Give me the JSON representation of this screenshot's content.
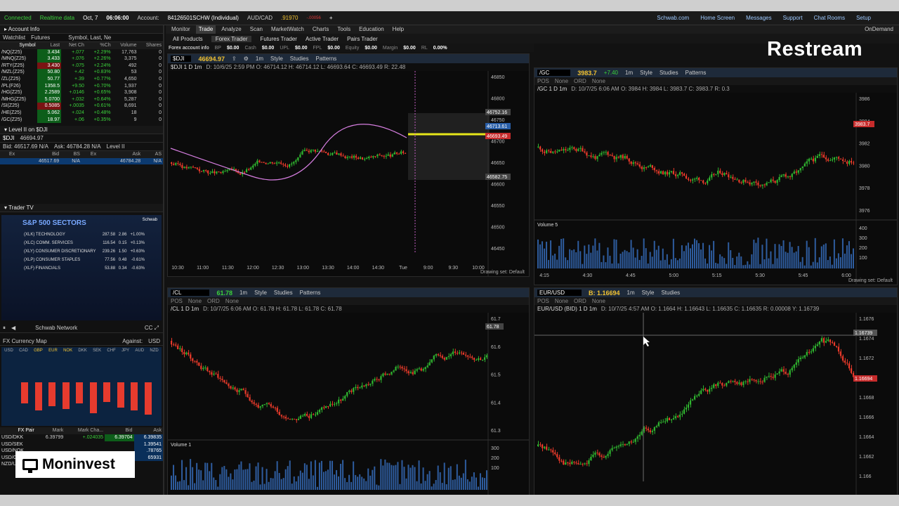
{
  "topbar": {
    "status": "Connected",
    "realtime": "Realtime data",
    "date": "Oct, 7",
    "time": "06:06:00",
    "account_label": "Account:",
    "account": "84126501SCHW (Individual)",
    "pair": "AUD/CAD",
    "pair_price": ".91970",
    "pair_chg": "-.00056",
    "links": [
      "Schwab.com",
      "Home Screen",
      "Messages",
      "Support",
      "Chat Rooms",
      "Setup"
    ]
  },
  "left": {
    "account_info": "Account Info",
    "watchlist": "Watchlist",
    "futures": "Futures",
    "symbol_lookup": "Symbol, Last, Ne",
    "headers": [
      "Symbol",
      "Last",
      "Net Ch",
      "%Ch",
      "Volume",
      "Shares"
    ],
    "rows": [
      [
        "/NQ(Z25)",
        "3.434",
        "+.077",
        "+2.29%",
        "17,763",
        "0"
      ],
      [
        "/MNQ(Z25)",
        "3.433",
        "+.076",
        "+2.26%",
        "3,375",
        "0"
      ],
      [
        "/RTY(Z25)",
        "3.430",
        "+.075",
        "+2.24%",
        "492",
        "0"
      ],
      [
        "/MZL(Z25)",
        "50.80",
        "+.42",
        "+0.83%",
        "53",
        "0"
      ],
      [
        "/ZL(Z25)",
        "50.77",
        "+.39",
        "+0.77%",
        "4,650",
        "0"
      ],
      [
        "/PL(F26)",
        "1358.5",
        "+9.50",
        "+0.70%",
        "1,937",
        "0"
      ],
      [
        "/HG(Z25)",
        "2.2589",
        "+.0146",
        "+0.65%",
        "3,908",
        "0"
      ],
      [
        "/MHG(Z25)",
        "5.0700",
        "+.032",
        "+0.64%",
        "5,287",
        "0"
      ],
      [
        "/SI(Z25)",
        "0.5085",
        "+.0035",
        "+0.61%",
        "8,691",
        "0"
      ],
      [
        "/HE(Z25)",
        "5.062",
        "+.024",
        "+0.48%",
        "18",
        "0"
      ],
      [
        "/GC(Z25)",
        "18.97",
        "+.06",
        "+0.35%",
        "9",
        "0"
      ]
    ],
    "level2_title": "Level II on $DJI",
    "level2_sym": "$DJI",
    "level2_price": "46694.97",
    "bid": "Bid: 46517.69 N/A",
    "ask": "Ask: 46784.28 N/A",
    "level_label": "Level II",
    "l2_headers": [
      "Ex",
      "Bid",
      "BS",
      "Ex",
      "Ask",
      "AS"
    ],
    "l2_row": [
      "",
      "46517.69",
      "N/A",
      "",
      "46784.28",
      "N/A"
    ],
    "trader_tv": "Trader TV",
    "tv_title": "S&P 500 SECTORS",
    "tv_brand": "Schwab",
    "sectors": [
      [
        "(XLK) TECHNOLOGY",
        "287.58",
        "2.86",
        "+1.00%"
      ],
      [
        "(XLC) COMM. SERVICES",
        "116.54",
        "0.15",
        "+0.13%"
      ],
      [
        "(XLY) CONSUMER DISCRETIONARY",
        "239.26",
        "1.50",
        "+0.63%"
      ],
      [
        "(XLP) CONSUMER STAPLES",
        "77.56",
        "0.48",
        "-0.61%"
      ],
      [
        "(XLF) FINANCIALS",
        "53.88",
        "0.34",
        "-0.63%"
      ]
    ],
    "schwab_network": "Schwab Network",
    "fx_title": "FX Currency Map",
    "against_label": "Against:",
    "against": "USD",
    "fx_currencies": [
      "USD",
      "CAD",
      "GBP",
      "EUR",
      "NOK",
      "DKK",
      "SEK",
      "CHF",
      "JPY",
      "AUD",
      "NZD"
    ],
    "fx_headers": [
      "FX Pair",
      "Mark",
      "Mark Cha...",
      "Bid",
      "Ask"
    ],
    "fx_rows": [
      [
        "USD/DKK",
        "6.39799",
        "+.024035",
        "6.39704",
        "6.39835"
      ],
      [
        "USD/SEK",
        "",
        "",
        "",
        "1.39541"
      ],
      [
        "USD/NOK",
        "",
        "",
        "",
        ".78765"
      ],
      [
        "USD/CHF",
        "",
        "",
        "",
        "65931"
      ],
      [
        "NZD/USD",
        "",
        "",
        ".58107",
        ""
      ]
    ],
    "moninvest": "Moninvest"
  },
  "nav": {
    "tabs": [
      "Monitor",
      "Trade",
      "Analyze",
      "Scan",
      "MarketWatch",
      "Charts",
      "Tools",
      "Education",
      "Help"
    ],
    "ondemand": "OnDemand"
  },
  "subtabs": [
    "All Products",
    "Forex Trader",
    "Futures Trader",
    "Active Trader",
    "Pairs Trader"
  ],
  "forex_info": {
    "label": "Forex account info",
    "items": [
      [
        "BP",
        "$0.00"
      ],
      [
        "Cash",
        "$0.00"
      ],
      [
        "UPL",
        "$0.00"
      ],
      [
        "FPL",
        "$0.00"
      ],
      [
        "Equity",
        "$0.00"
      ],
      [
        "Margin",
        "$0.00"
      ],
      [
        "RL",
        "0.00%"
      ]
    ]
  },
  "restream": "Restream",
  "toolbar": {
    "style": "Style",
    "studies": "Studies",
    "patterns": "Patterns",
    "drawing": "Drawing set: Default",
    "interval": "1m",
    "pos": "POS",
    "none": "None",
    "ord": "ORD"
  },
  "charts": [
    {
      "id": "dji",
      "symbol": "$DJI",
      "price": "46694.97",
      "info": "$DJI 1 D 1m",
      "ohlc": "D: 10/6/25 2:59 PM  O: 46714.12  H: 46714.12  L: 46693.64  C: 46693.49  R: 22.48",
      "xticks": [
        "10:30",
        "11:00",
        "11:30",
        "12:00",
        "12:30",
        "13:00",
        "13:30",
        "14:00",
        "14:30",
        "Tue",
        "9:00",
        "9:30",
        "10:00"
      ],
      "yticks": [
        "46850",
        "46800",
        "46750",
        "46700",
        "46650",
        "46600",
        "46550",
        "46500",
        "46450"
      ],
      "labels": [
        "46752.16",
        "46713.61",
        "46693.49",
        "46582.75"
      ]
    },
    {
      "id": "gc",
      "symbol": "/GC",
      "price": "3983.7",
      "chg": "+7.40",
      "info": "/GC 1 D 1m",
      "ohlc": "D: 10/7/25 6:06 AM  O: 3984  H: 3984  L: 3983.7  C: 3983.7  R: 0.3",
      "xticks": [
        "4:15",
        "4:30",
        "4:45",
        "5:00",
        "5:15",
        "5:30",
        "5:45",
        "6:00"
      ],
      "yticks": [
        "3986",
        "3984",
        "3982",
        "3980",
        "3978",
        "3976"
      ],
      "vticks": [
        "400",
        "300",
        "200",
        "100"
      ],
      "volume": "Volume 5",
      "last": "3983.7"
    },
    {
      "id": "cl",
      "symbol": "/CL",
      "price": "61.78",
      "info": "/CL 1 D 1m",
      "ohlc": "D: 10/7/25 6:06 AM  O: 61.78  H: 61.78  L: 61.78  C: 61.78",
      "xticks": [
        "3:45",
        "4:00",
        "4:15",
        "4:30",
        "4:45",
        "5:00",
        "5:15",
        "5:30",
        "5:45",
        "6:00"
      ],
      "yticks": [
        "61.7",
        "61.6",
        "61.5",
        "61.4",
        "61.3"
      ],
      "vticks": [
        "300",
        "200",
        "100"
      ],
      "volume": "Volume 1",
      "last": "61.78"
    },
    {
      "id": "eur",
      "symbol": "EUR/USD",
      "price": "B: 1.16694",
      "info": "EUR/USD (BID) 1 D 1m",
      "ohlc": "D: 10/7/25 4:57 AM  O: 1.1664  H: 1.16643  L: 1.16635  C: 1.16635  R: 0.00008  Y: 1.16739",
      "xticks": [
        "4:30",
        "4:45",
        "4:57",
        "5:00",
        "5:15",
        "5:30",
        "5:45",
        "6:00"
      ],
      "yticks": [
        "1.1676",
        "1.1674",
        "1.1672",
        "1.167",
        "1.1668",
        "1.1666",
        "1.1664",
        "1.1662",
        "1.166"
      ],
      "labels": [
        "1.16739",
        "1.16694"
      ]
    }
  ]
}
